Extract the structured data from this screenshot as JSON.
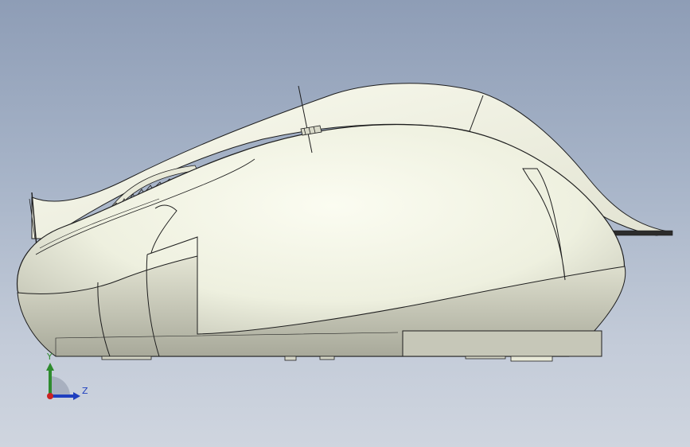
{
  "viewport": {
    "background_top": "#8e9db6",
    "background_bottom": "#cfd5df",
    "model": "computer-mouse-side-view",
    "model_color": "#f3f4e4"
  },
  "triad": {
    "y_label": "Y",
    "z_label": "Z",
    "y_color": "#2e8b2e",
    "z_color": "#1f3fbf",
    "origin_color": "#cc2222"
  }
}
